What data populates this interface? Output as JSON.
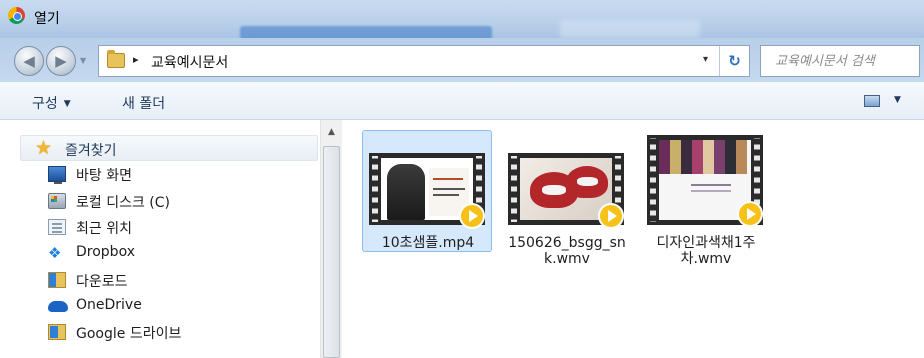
{
  "window": {
    "title": "열기",
    "icon": "chrome-icon"
  },
  "navigation": {
    "back": "back-icon",
    "forward": "forward-icon"
  },
  "address_bar": {
    "path": [
      "교육예시문서"
    ],
    "separator": "▸",
    "dropdown": "▾",
    "refresh": "refresh-icon"
  },
  "search": {
    "placeholder": "교육예시문서 검색"
  },
  "toolbar": {
    "organize": "구성",
    "new_folder": "새 폴더",
    "view_icon": "view-options-icon"
  },
  "nav_pane": {
    "favorites_label": "즐겨찾기",
    "items": [
      {
        "label": "바탕 화면",
        "icon": "desktop-icon"
      },
      {
        "label": "로컬 디스크 (C)",
        "icon": "disk-icon"
      },
      {
        "label": "최근 위치",
        "icon": "recent-places-icon"
      },
      {
        "label": "Dropbox",
        "icon": "dropbox-icon"
      },
      {
        "label": "다운로드",
        "icon": "downloads-folder-icon"
      },
      {
        "label": "OneDrive",
        "icon": "onedrive-icon"
      },
      {
        "label": "Google 드라이브",
        "icon": "google-drive-folder-icon"
      }
    ]
  },
  "files": [
    {
      "name": "10초샘플.mp4",
      "selected": true,
      "type": "video"
    },
    {
      "name": "150626_bsgg_snk.wmv",
      "name_lines": [
        "150626_bsgg_sn",
        "k.wmv"
      ],
      "selected": false,
      "type": "video"
    },
    {
      "name": "디자인과색채1주차.wmv",
      "name_lines": [
        "디자인과색채1주",
        "차.wmv"
      ],
      "selected": false,
      "type": "video"
    }
  ],
  "colors": {
    "selection": "#d6e8fb",
    "play_badge": "#f6c21a",
    "toolbar_text": "#1e395b"
  }
}
